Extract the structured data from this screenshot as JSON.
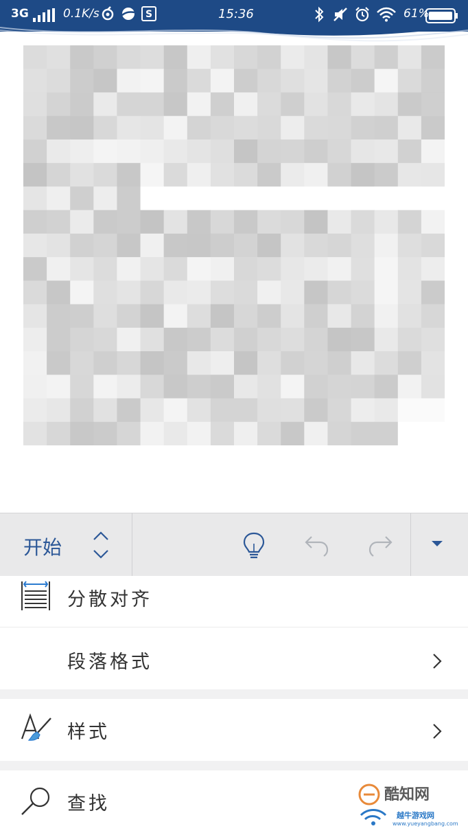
{
  "status_bar": {
    "network": "3G",
    "speed": "0.1K/s",
    "time": "15:36",
    "battery": "61%",
    "icons": [
      "signal-icon",
      "app-status-icon",
      "planet-icon",
      "app-s-icon",
      "bluetooth-icon",
      "mute-icon",
      "alarm-icon",
      "wifi-icon",
      "battery-icon"
    ],
    "colors": {
      "background": "#1e4a86",
      "text": "#ffffff"
    }
  },
  "document": {
    "content": "pixelated-redacted"
  },
  "ribbon": {
    "tab_label": "开始",
    "icons": [
      "tab-switch-icon",
      "lightbulb-icon",
      "undo-icon",
      "redo-icon",
      "expand-icon"
    ],
    "accent": "#2b5797",
    "background": "#e9e9ea"
  },
  "menu": {
    "items": [
      {
        "label": "分散对齐",
        "icon": "distributed-align-icon"
      },
      {
        "label": "段落格式",
        "icon": "",
        "has_chevron": true
      },
      {
        "label": "样式",
        "icon": "styles-icon",
        "has_chevron": true
      },
      {
        "label": "查找",
        "icon": "search-icon"
      }
    ]
  },
  "watermark": {
    "line1": "酷知网",
    "line2": "越牛游戏网",
    "line3": "www.yueyangbang.com"
  }
}
